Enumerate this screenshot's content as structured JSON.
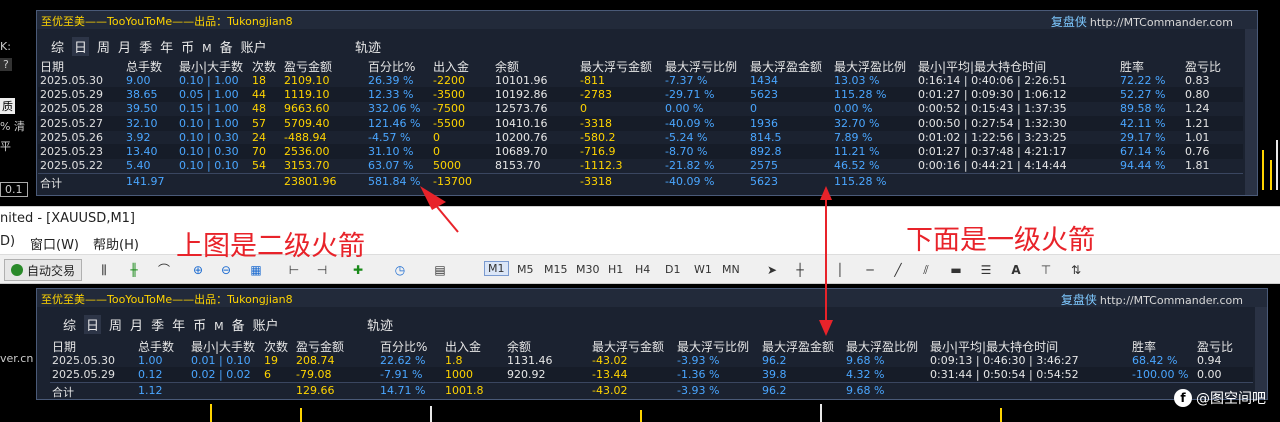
{
  "window": {
    "title": "nited - [XAUUSD,M1]"
  },
  "menu": {
    "items": [
      "D)",
      "窗口(W)",
      "帮助(H)"
    ]
  },
  "left_fragments": [
    "K:",
    "?",
    "质",
    "% 清",
    "平",
    "0.1",
    "ver.cn"
  ],
  "toolbar": {
    "auto_trade": "自动交易",
    "timeframes": [
      "M1",
      "M5",
      "M15",
      "M30",
      "H1",
      "H4",
      "D1",
      "W1",
      "MN"
    ],
    "selected_timeframe": "M1",
    "text_tool": "A"
  },
  "colors": {
    "panel_bg": "#1b2230",
    "value_blue": "#4aa6ff",
    "value_yellow": "#ffd400",
    "annotation_red": "#e8232a"
  },
  "panels": [
    {
      "title": "至优至美——TooYouToMe——出品：Tukongjian8",
      "brand_cn": "复盘侠",
      "brand_url": "http://MTCommander.com",
      "tabs": [
        "综",
        "日",
        "周",
        "月",
        "季",
        "年",
        "币",
        "M",
        "备",
        "账户"
      ],
      "active_tab": "日",
      "trail": "轨迹",
      "headers": [
        "日期",
        "总手数",
        "最小|大手数",
        "次数",
        "盈亏金额",
        "百分比%",
        "出入金",
        "余额",
        "最大浮亏金额",
        "最大浮亏比例",
        "最大浮盈金额",
        "最大浮盈比例",
        "最小|平均|最大持仓时间",
        "胜率",
        "盈亏比"
      ],
      "rows": [
        [
          "2025.05.30",
          "9.00",
          "0.10 | 1.00",
          "18",
          "2109.10",
          "26.39 %",
          "-2200",
          "10101.96",
          "-811",
          "-7.37 %",
          "1434",
          "13.03 %",
          "0:16:14 | 0:40:06 | 2:26:51",
          "72.22 %",
          "0.83"
        ],
        [
          "2025.05.29",
          "38.65",
          "0.05 | 1.00",
          "44",
          "1119.10",
          "12.33 %",
          "-3500",
          "10192.86",
          "-2783",
          "-29.71 %",
          "5623",
          "115.28 %",
          "0:01:27 | 0:09:30 | 1:06:12",
          "52.27 %",
          "0.80"
        ],
        [
          "2025.05.28",
          "39.50",
          "0.15 | 1.00",
          "48",
          "9663.60",
          "332.06 %",
          "-7500",
          "12573.76",
          "0",
          "0.00 %",
          "0",
          "0.00 %",
          "0:00:52 | 0:15:43 | 1:37:35",
          "89.58 %",
          "1.24"
        ],
        [
          "2025.05.27",
          "32.10",
          "0.10 | 1.00",
          "57",
          "5709.40",
          "121.46 %",
          "-5500",
          "10410.16",
          "-3318",
          "-40.09 %",
          "1936",
          "32.70 %",
          "0:00:50 | 0:27:54 | 1:32:30",
          "42.11 %",
          "1.21"
        ],
        [
          "2025.05.26",
          "3.92",
          "0.10 | 0.30",
          "24",
          "-488.94",
          "-4.57 %",
          "0",
          "10200.76",
          "-580.2",
          "-5.24 %",
          "814.5",
          "7.89 %",
          "0:01:02 | 1:22:56 | 3:23:25",
          "29.17 %",
          "1.01"
        ],
        [
          "2025.05.23",
          "13.40",
          "0.10 | 0.30",
          "70",
          "2536.00",
          "31.10 %",
          "0",
          "10689.70",
          "-716.9",
          "-8.70 %",
          "892.8",
          "11.21 %",
          "0:01:27 | 0:37:48 | 4:21:17",
          "67.14 %",
          "0.76"
        ],
        [
          "2025.05.22",
          "5.40",
          "0.10 | 0.10",
          "54",
          "3153.70",
          "63.07 %",
          "5000",
          "8153.70",
          "-1112.3",
          "-21.82 %",
          "2575",
          "46.52 %",
          "0:00:16 | 0:44:21 | 4:14:44",
          "94.44 %",
          "1.81"
        ]
      ],
      "total": [
        "合计",
        "141.97",
        "",
        "",
        "23801.96",
        "581.84 %",
        "-13700",
        "",
        "-3318",
        "-40.09 %",
        "5623",
        "115.28 %",
        "",
        "",
        ""
      ]
    },
    {
      "title": "至优至美——TooYouToMe——出品：Tukongjian8",
      "brand_cn": "复盘侠",
      "brand_url": "http://MTCommander.com",
      "tabs": [
        "综",
        "日",
        "周",
        "月",
        "季",
        "年",
        "币",
        "M",
        "备",
        "账户"
      ],
      "active_tab": "日",
      "trail": "轨迹",
      "headers": [
        "日期",
        "总手数",
        "最小|大手数",
        "次数",
        "盈亏金额",
        "百分比%",
        "出入金",
        "余额",
        "最大浮亏金额",
        "最大浮亏比例",
        "最大浮盈金额",
        "最大浮盈比例",
        "最小|平均|最大持仓时间",
        "胜率",
        "盈亏比"
      ],
      "rows": [
        [
          "2025.05.30",
          "1.00",
          "0.01 | 0.10",
          "19",
          "208.74",
          "22.62 %",
          "1.8",
          "1131.46",
          "-43.02",
          "-3.93 %",
          "96.2",
          "9.68 %",
          "0:09:13 | 0:46:30 | 3:46:27",
          "68.42 %",
          "0.94"
        ],
        [
          "2025.05.29",
          "0.12",
          "0.02 | 0.02",
          "6",
          "-79.08",
          "-7.91 %",
          "1000",
          "920.92",
          "-13.44",
          "-1.36 %",
          "39.8",
          "4.32 %",
          "0:31:44 | 0:50:54 | 0:54:52",
          "-100.00 %",
          "0.00"
        ]
      ],
      "total": [
        "合计",
        "1.12",
        "",
        "",
        "129.66",
        "14.71 %",
        "1001.8",
        "",
        "-43.02",
        "-3.93 %",
        "96.2",
        "9.68 %",
        "",
        "",
        ""
      ]
    }
  ],
  "annotations": {
    "upper": "上图是二级火箭",
    "lower": "下面是一级火箭"
  },
  "watermark": "@图空间吧"
}
